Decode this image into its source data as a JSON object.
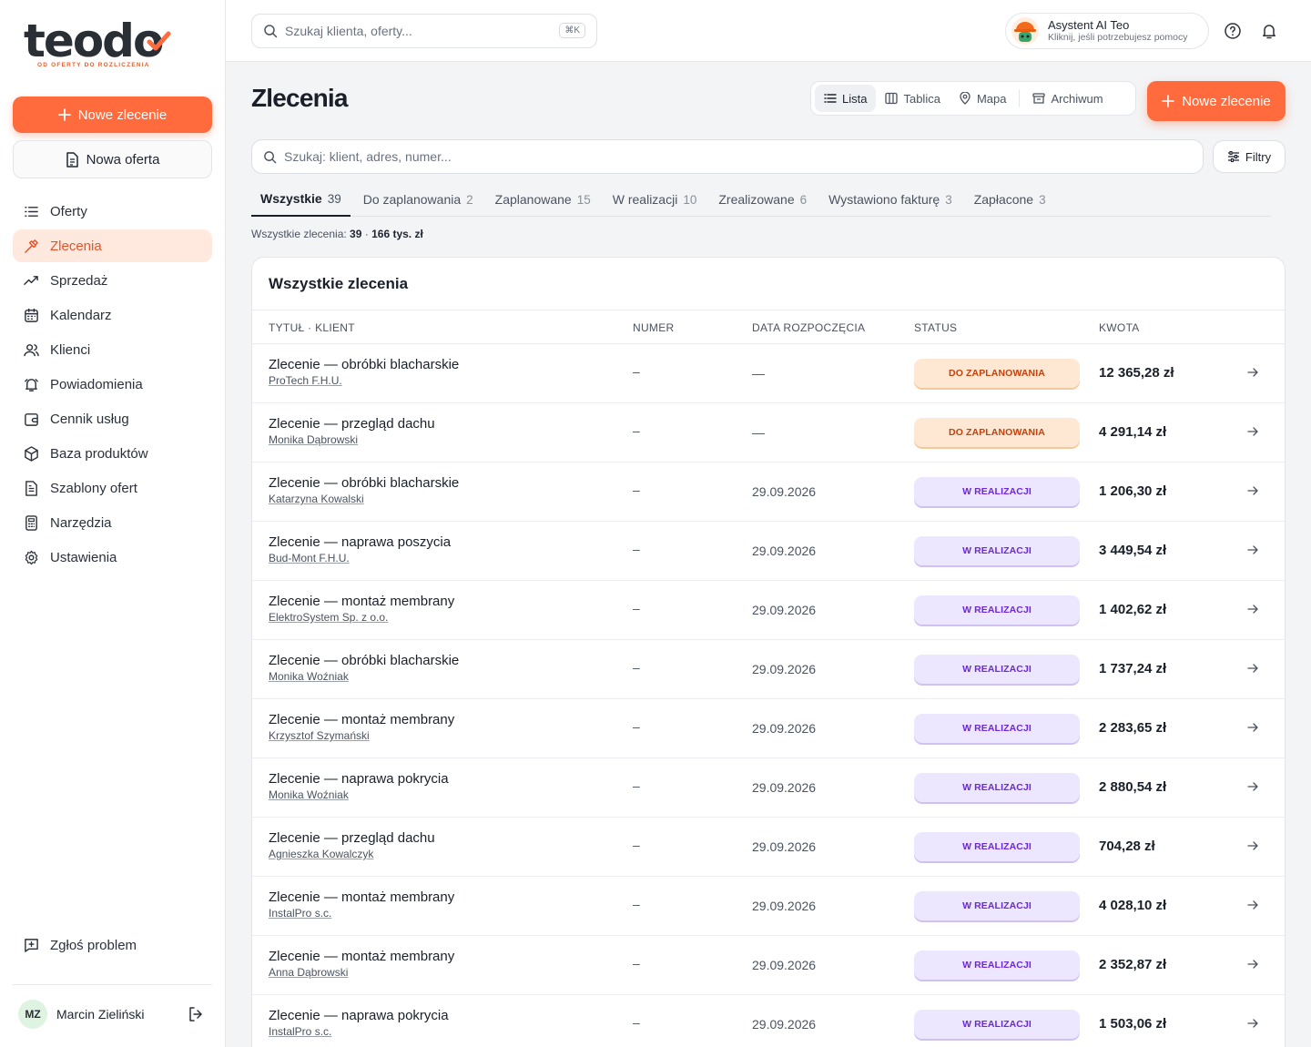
{
  "brand": {
    "name": "teodo",
    "tagline": "OD OFERTY DO ROZLICZENIA",
    "accent": "#ff6b3d"
  },
  "sidebar": {
    "new_order_label": "Nowe zlecenie",
    "new_offer_label": "Nowa oferta",
    "items": [
      {
        "label": "Oferty",
        "icon": "list-icon"
      },
      {
        "label": "Zlecenia",
        "icon": "hammer-icon",
        "active": true
      },
      {
        "label": "Sprzedaż",
        "icon": "trend-icon"
      },
      {
        "label": "Kalendarz",
        "icon": "calendar-icon"
      },
      {
        "label": "Klienci",
        "icon": "users-icon"
      },
      {
        "label": "Powiadomienia",
        "icon": "bell-icon"
      },
      {
        "label": "Cennik usług",
        "icon": "wallet-icon"
      },
      {
        "label": "Baza produktów",
        "icon": "box-icon"
      },
      {
        "label": "Szablony ofert",
        "icon": "document-icon"
      },
      {
        "label": "Narzędzia",
        "icon": "calculator-icon"
      },
      {
        "label": "Ustawienia",
        "icon": "gear-icon"
      }
    ],
    "report_label": "Zgłoś problem",
    "user": {
      "initials": "MZ",
      "name": "Marcin Zieliński"
    }
  },
  "topbar": {
    "search_placeholder": "Szukaj klienta, oferty...",
    "shortcut": "⌘K",
    "assistant_title": "Asystent AI Teo",
    "assistant_subtitle": "Kliknij, jeśli potrzebujesz pomocy"
  },
  "page": {
    "title": "Zlecenia",
    "views": [
      {
        "label": "Lista",
        "icon": "list-icon",
        "active": true
      },
      {
        "label": "Tablica",
        "icon": "columns-icon"
      },
      {
        "label": "Mapa",
        "icon": "map-pin-icon"
      },
      {
        "label": "Archiwum",
        "icon": "archive-icon"
      }
    ],
    "new_order_label": "Nowe zlecenie",
    "search_placeholder": "Szukaj: klient, adres, numer...",
    "filters_label": "Filtry",
    "tabs": [
      {
        "label": "Wszystkie",
        "count": "39",
        "active": true
      },
      {
        "label": "Do zaplanowania",
        "count": "2"
      },
      {
        "label": "Zaplanowane",
        "count": "15"
      },
      {
        "label": "W realizacji",
        "count": "10"
      },
      {
        "label": "Zrealizowane",
        "count": "6"
      },
      {
        "label": "Wystawiono fakturę",
        "count": "3"
      },
      {
        "label": "Zapłacone",
        "count": "3"
      }
    ],
    "summary_prefix": "Wszystkie zlecenia:",
    "summary_count": "39",
    "summary_sep": "·",
    "summary_total": "166 tys. zł"
  },
  "table": {
    "title": "Wszystkie zlecenia",
    "columns": [
      "TYTUŁ · KLIENT",
      "NUMER",
      "DATA ROZPOCZĘCIA",
      "STATUS",
      "KWOTA"
    ],
    "rows": [
      {
        "title": "Zlecenie — obróbki blacharskie",
        "client": "ProTech F.H.U.",
        "number": "–",
        "date": "—",
        "status": "DO ZAPLANOWANIA",
        "status_type": "plan",
        "amount": "12 365,28 zł"
      },
      {
        "title": "Zlecenie — przegląd dachu",
        "client": "Monika Dąbrowski",
        "number": "–",
        "date": "—",
        "status": "DO ZAPLANOWANIA",
        "status_type": "plan",
        "amount": "4 291,14 zł"
      },
      {
        "title": "Zlecenie — obróbki blacharskie",
        "client": "Katarzyna Kowalski",
        "number": "–",
        "date": "29.09.2026",
        "status": "W REALIZACJI",
        "status_type": "real",
        "amount": "1 206,30 zł"
      },
      {
        "title": "Zlecenie — naprawa poszycia",
        "client": "Bud-Mont F.H.U.",
        "number": "–",
        "date": "29.09.2026",
        "status": "W REALIZACJI",
        "status_type": "real",
        "amount": "3 449,54 zł"
      },
      {
        "title": "Zlecenie — montaż membrany",
        "client": "ElektroSystem Sp. z o.o.",
        "number": "–",
        "date": "29.09.2026",
        "status": "W REALIZACJI",
        "status_type": "real",
        "amount": "1 402,62 zł"
      },
      {
        "title": "Zlecenie — obróbki blacharskie",
        "client": "Monika Woźniak",
        "number": "–",
        "date": "29.09.2026",
        "status": "W REALIZACJI",
        "status_type": "real",
        "amount": "1 737,24 zł"
      },
      {
        "title": "Zlecenie — montaż membrany",
        "client": "Krzysztof Szymański",
        "number": "–",
        "date": "29.09.2026",
        "status": "W REALIZACJI",
        "status_type": "real",
        "amount": "2 283,65 zł"
      },
      {
        "title": "Zlecenie — naprawa pokrycia",
        "client": "Monika Woźniak",
        "number": "–",
        "date": "29.09.2026",
        "status": "W REALIZACJI",
        "status_type": "real",
        "amount": "2 880,54 zł"
      },
      {
        "title": "Zlecenie — przegląd dachu",
        "client": "Agnieszka Kowalczyk",
        "number": "–",
        "date": "29.09.2026",
        "status": "W REALIZACJI",
        "status_type": "real",
        "amount": "704,28 zł"
      },
      {
        "title": "Zlecenie — montaż membrany",
        "client": "InstalPro s.c.",
        "number": "–",
        "date": "29.09.2026",
        "status": "W REALIZACJI",
        "status_type": "real",
        "amount": "4 028,10 zł"
      },
      {
        "title": "Zlecenie — montaż membrany",
        "client": "Anna Dąbrowski",
        "number": "–",
        "date": "29.09.2026",
        "status": "W REALIZACJI",
        "status_type": "real",
        "amount": "2 352,87 zł"
      },
      {
        "title": "Zlecenie — naprawa pokrycia",
        "client": "InstalPro s.c.",
        "number": "–",
        "date": "29.09.2026",
        "status": "W REALIZACJI",
        "status_type": "real",
        "amount": "1 503,06 zł"
      }
    ]
  }
}
